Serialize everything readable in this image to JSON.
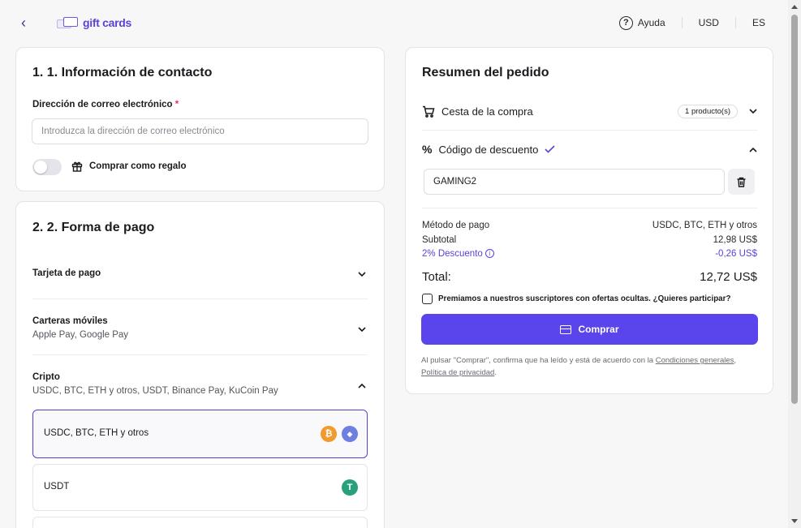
{
  "header": {
    "logo_text": "gift cards",
    "help_label": "Ayuda",
    "help_glyph": "?",
    "currency": "USD",
    "language": "ES"
  },
  "contact": {
    "title": "1. 1. Información de contacto",
    "email_label": "Dirección de correo electrónico",
    "required_mark": "*",
    "email_placeholder": "Introduzca la dirección de correo electrónico",
    "email_value": "",
    "gift_label": "Comprar como regalo",
    "gift_on": false
  },
  "payment": {
    "title": "2. 2. Forma de pago",
    "methods": [
      {
        "title": "Tarjeta de pago",
        "subtitle": "",
        "expanded": false
      },
      {
        "title": "Carteras móviles",
        "subtitle": "Apple Pay, Google Pay",
        "expanded": false
      },
      {
        "title": "Cripto",
        "subtitle": "USDC, BTC, ETH y otros, USDT, Binance Pay, KuCoin Pay",
        "expanded": true
      }
    ],
    "crypto_options": [
      {
        "label": "USDC, BTC, ETH y otros",
        "selected": true
      },
      {
        "label": "USDT",
        "selected": false
      }
    ],
    "coins": {
      "btc": "₿",
      "eth": "◆",
      "usdt": "T"
    },
    "colors": {
      "btc": "#f29a2e",
      "eth": "#6f7fe0",
      "usdt": "#26a17b"
    }
  },
  "summary": {
    "title": "Resumen del pedido",
    "cart_label": "Cesta de la compra",
    "cart_count": "1 producto(s)",
    "discount_label": "Código de descuento",
    "discount_code": "GAMING2",
    "payment_method_label": "Método de pago",
    "payment_method_value": "USDC, BTC, ETH y otros",
    "subtotal_label": "Subtotal",
    "subtotal_value": "12,98 US$",
    "discount_line_label": "2% Descuento",
    "discount_line_value": "-0,26 US$",
    "total_label": "Total:",
    "total_value": "12,72 US$",
    "newsletter_text": "Premiamos a nuestros suscriptores con ofertas ocultas. ¿Quieres participar?",
    "buy_label": "Comprar",
    "legal_prefix": "Al pulsar \"Comprar\", confirma que ha leído y está de acuerdo con la",
    "terms_link": "Condiciones generales",
    "privacy_link": "Política de privacidad",
    "accent_color": "#5a45ec"
  }
}
